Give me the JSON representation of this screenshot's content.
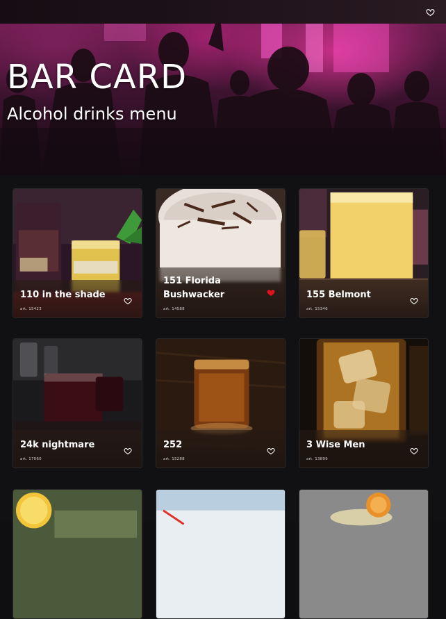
{
  "hero": {
    "title": "BAR CARD",
    "subtitle": "Alcohol drinks menu"
  },
  "topbar": {
    "favorites_icon": "heart-outline-icon"
  },
  "cards": [
    {
      "name": "110 in the shade",
      "art": "art. 15423",
      "favorite": false
    },
    {
      "name": "151 Florida Bushwacker",
      "art": "art. 14588",
      "favorite": true
    },
    {
      "name": "155 Belmont",
      "art": "art. 15346",
      "favorite": false
    },
    {
      "name": "24k nightmare",
      "art": "art. 17060",
      "favorite": false
    },
    {
      "name": "252",
      "art": "art. 15288",
      "favorite": false
    },
    {
      "name": "3 Wise Men",
      "art": "art. 13899",
      "favorite": false
    }
  ],
  "colors": {
    "background": "#0f0f11",
    "favorite_active": "#e0121f",
    "hero_accent": "#c2267e"
  }
}
